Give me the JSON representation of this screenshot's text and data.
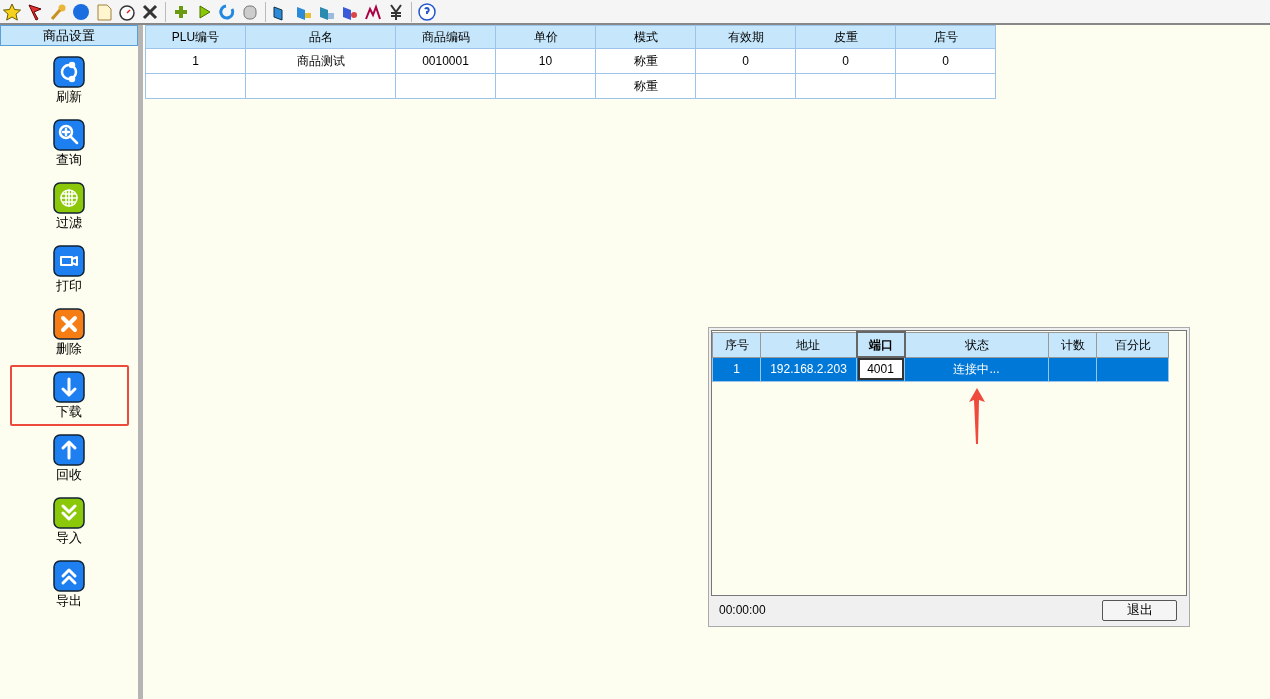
{
  "sidebar": {
    "title": "商品设置",
    "items": [
      {
        "label": "刷新",
        "kind": "refresh",
        "color": "#1e7ff0",
        "highlighted": false
      },
      {
        "label": "查询",
        "kind": "zoom",
        "color": "#1e7ff0",
        "highlighted": false
      },
      {
        "label": "过滤",
        "kind": "globe",
        "color": "#8cc80a",
        "highlighted": false
      },
      {
        "label": "打印",
        "kind": "camera",
        "color": "#1e7ff0",
        "highlighted": false
      },
      {
        "label": "删除",
        "kind": "delete",
        "color": "#f57d14",
        "highlighted": false
      },
      {
        "label": "下载",
        "kind": "down",
        "color": "#1e7ff0",
        "highlighted": true
      },
      {
        "label": "回收",
        "kind": "up",
        "color": "#1e7ff0",
        "highlighted": false
      },
      {
        "label": "导入",
        "kind": "chevrons-down",
        "color": "#8cc80a",
        "highlighted": false
      },
      {
        "label": "导出",
        "kind": "chevrons-up",
        "color": "#1e7ff0",
        "highlighted": false
      }
    ]
  },
  "table": {
    "columns": [
      "PLU编号",
      "品名",
      "商品编码",
      "单价",
      "模式",
      "有效期",
      "皮重",
      "店号"
    ],
    "rows": [
      [
        "1",
        "商品测试",
        "0010001",
        "10",
        "称重",
        "0",
        "0",
        "0"
      ],
      [
        "",
        "",
        "",
        "",
        "称重",
        "",
        "",
        ""
      ]
    ]
  },
  "dialog": {
    "columns": [
      {
        "label": "序号",
        "focused": false
      },
      {
        "label": "地址",
        "focused": false
      },
      {
        "label": "端口",
        "focused": true
      },
      {
        "label": "状态",
        "focused": false
      },
      {
        "label": "计数",
        "focused": false
      },
      {
        "label": "百分比",
        "focused": false
      }
    ],
    "rows": [
      {
        "selected": true,
        "cells": [
          {
            "text": "1",
            "editing": false
          },
          {
            "text": "192.168.2.203",
            "editing": false
          },
          {
            "text": "4001",
            "editing": true
          },
          {
            "text": "连接中...",
            "editing": false
          },
          {
            "text": "",
            "editing": false
          },
          {
            "text": "",
            "editing": false
          }
        ]
      }
    ],
    "timer": "00:00:00",
    "exit_button": "退出"
  }
}
